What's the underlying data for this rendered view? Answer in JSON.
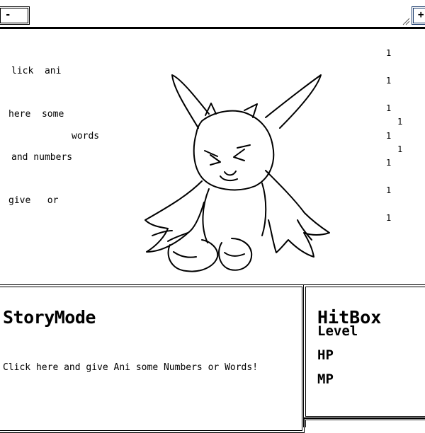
{
  "window": {
    "minimize_label": "-",
    "maximize_label": "+"
  },
  "scene": {
    "words": [
      "lick  ani",
      "here  some",
      "words",
      "and numbers",
      "give   or"
    ],
    "ones": [
      "1",
      "1",
      "1",
      "1",
      "1",
      "1",
      "1",
      "1",
      "1",
      "1"
    ]
  },
  "story": {
    "title": "StoryMode",
    "prompt": "Click here and give Ani some Numbers or Words!"
  },
  "hitbox": {
    "title": "HitBox",
    "level_label": "Level",
    "hp_label": "HP",
    "mp_label": "MP"
  }
}
